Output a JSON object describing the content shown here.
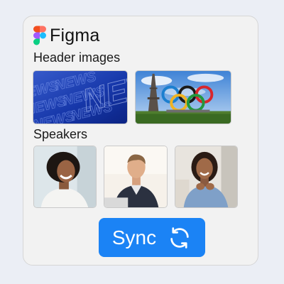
{
  "brand": {
    "name": "Figma",
    "icon": "figma-logo"
  },
  "sections": {
    "header_images": {
      "title": "Header images"
    },
    "speakers": {
      "title": "Speakers"
    }
  },
  "thumbnails": {
    "header": [
      "news-banner-image",
      "eiffel-tower-olympic-rings-image"
    ],
    "speakers": [
      "speaker-woman-smiling-image",
      "speaker-man-laptop-image",
      "speaker-woman-office-image"
    ]
  },
  "watermark": {
    "text": "NEWS"
  },
  "button": {
    "label": "Sync",
    "icon": "sync-icon"
  },
  "colors": {
    "accent": "#1b83f5",
    "background": "#ebeef5",
    "card": "#f2f2f2"
  }
}
